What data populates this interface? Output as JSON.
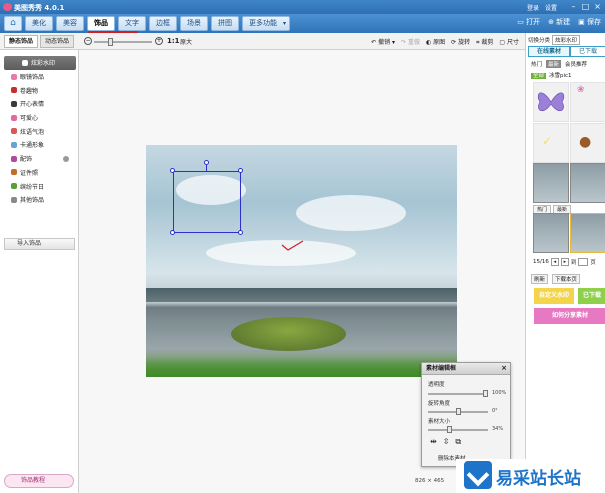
{
  "app": {
    "title": "美图秀秀 4.0.1"
  },
  "titlebar": {
    "links": [
      "登录",
      "设置"
    ]
  },
  "nav": {
    "tabs": [
      {
        "label": "美化"
      },
      {
        "label": "美容"
      },
      {
        "label": "饰品"
      },
      {
        "label": "文字"
      },
      {
        "label": "边框"
      },
      {
        "label": "场景"
      },
      {
        "label": "拼图"
      },
      {
        "label": "更多功能"
      }
    ],
    "active_tab": "饰品",
    "right": {
      "open": "打开",
      "new": "新建",
      "save": "保存"
    }
  },
  "subtabs": [
    "静态饰品",
    "动态饰品"
  ],
  "zoom": {
    "ratio": "1:1",
    "fit": "原大"
  },
  "tools": {
    "undo": "撤销",
    "redo": "重做",
    "original": "原图",
    "rotate": "旋转",
    "crop": "裁剪",
    "size": "尺寸"
  },
  "categories": [
    {
      "label": "炫彩水印",
      "color": "#ffffff"
    },
    {
      "label": "眼镜饰品",
      "color": "#e77aa8"
    },
    {
      "label": "卷趣物",
      "color": "#c4302b"
    },
    {
      "label": "开心表情",
      "color": "#3a3a3a"
    },
    {
      "label": "可爱心",
      "color": "#e46aa0"
    },
    {
      "label": "炫语气泡",
      "color": "#d95757"
    },
    {
      "label": "卡通形象",
      "color": "#67a3d8"
    },
    {
      "label": "配饰",
      "color": "#b14b9c"
    },
    {
      "label": "证件照",
      "color": "#c46b2d"
    },
    {
      "label": "缤纷节日",
      "color": "#56a035"
    },
    {
      "label": "其他饰品",
      "color": "#8a8a8a"
    }
  ],
  "import_button": "导入饰品",
  "tutorial_button": "饰品教程",
  "editor": {
    "title": "素材编辑框",
    "opacity_label": "透明度",
    "opacity_value": "100%",
    "opacity": 1.0,
    "rotation_label": "旋转角度",
    "rotation_value": "0°",
    "rotation": 0.5,
    "size_label": "素材大小",
    "size_value": "34%",
    "size": 0.34,
    "delete_label": "删除本素材"
  },
  "status": {
    "dims": "826 × 465"
  },
  "right_panel": {
    "filter_label": "切换分类",
    "filter_value": "炫彩水印",
    "tabs": [
      "在线素材",
      "已下载"
    ],
    "subfilters": [
      "热门",
      "最新",
      "会员推荐"
    ],
    "tag_all": "全部",
    "tag_text": "冰雪pic1",
    "sec2_tabs": [
      "热门",
      "最新"
    ],
    "page": "15/16",
    "page_to": "到",
    "page_unit": "页",
    "actions": [
      "刷新",
      "下载本页"
    ],
    "banner1": "自定义水印",
    "banner2": "已下载",
    "banner3": "如何分享素材"
  },
  "watermark": {
    "text": "易采站长站"
  }
}
